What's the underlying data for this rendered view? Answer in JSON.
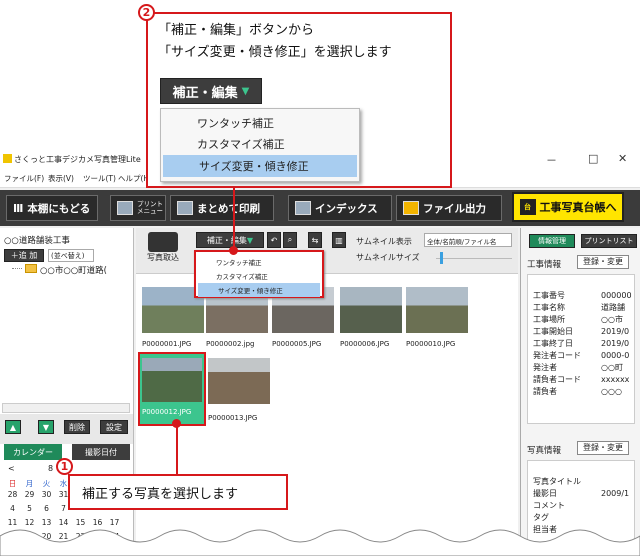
{
  "step2": {
    "number": "2",
    "line1": "「補正・編集」ボタンから",
    "line2": "「サイズ変更・傾き修正」を選択します",
    "button_label": "補正・編集",
    "menu": [
      "ワンタッチ補正",
      "カスタマイズ補正",
      "サイズ変更・傾き修正"
    ]
  },
  "step1": {
    "number": "1",
    "text": "補正する写真を選択します"
  },
  "window": {
    "title": "さくっと工事デジカメ写真管理Lite",
    "controls": [
      "－",
      "□",
      "✕"
    ]
  },
  "menubar": [
    "ファイル(F)",
    "表示(V)",
    "ツール(T)",
    "ヘルプ(H)"
  ],
  "toolbar": {
    "back": "本棚にもどる",
    "print_small": "プリント\nメニュー",
    "bulk_print": "まとめて印刷",
    "index": "インデックス",
    "file_output": "ファイル出力",
    "ledger": "工事写真台帳へ"
  },
  "left": {
    "project": "○○道路舗装工事",
    "add": "追 加",
    "sort": "(並べ替え)",
    "folder": "○○市○○町道路(",
    "delete": "削除",
    "settings": "設定",
    "calendar": "カレンダー",
    "shoot_date": "撮影日付",
    "month": "8",
    "weekdays": [
      "日",
      "月",
      "火",
      "水"
    ],
    "weeks": [
      [
        "28",
        "29",
        "30",
        "31"
      ],
      [
        "4",
        "5",
        "6",
        "7"
      ],
      [
        "11",
        "12",
        "13",
        "14",
        "15",
        "16",
        "17"
      ],
      [
        "18",
        "19",
        "20",
        "21",
        "22",
        "23",
        "24"
      ]
    ]
  },
  "middle": {
    "import": "写真取込",
    "edit_button": "補正・編集",
    "thumb_display_label": "サムネイル表示",
    "thumb_display_value": "全体/名前順/ファイル名",
    "thumb_size_label": "サムネイルサイズ",
    "menu": [
      "ワンタッチ補正",
      "カスタマイズ補正",
      "サイズ変更・傾き修正"
    ],
    "photos": [
      "P0000001.JPG",
      "P0000002.jpg",
      "P0000005.JPG",
      "P0000006.JPG",
      "P0000010.JPG",
      "P0000012.JPG",
      "P0000013.JPG"
    ]
  },
  "right": {
    "tab1": "情報管理",
    "tab2": "プリントリスト",
    "work_info": "工事情報",
    "register": "登録・変更",
    "work_fields": [
      [
        "工事番号",
        "000000"
      ],
      [
        "工事名称",
        "道路舗"
      ],
      [
        "工事場所",
        "○○市"
      ],
      [
        "工事開始日",
        "2019/0"
      ],
      [
        "工事終了日",
        "2019/0"
      ],
      [
        "発注者コード",
        "0000-0"
      ],
      [
        "発注者",
        "○○町"
      ],
      [
        "請負者コード",
        "xxxxxx"
      ],
      [
        "請負者",
        "○○○"
      ]
    ],
    "photo_info": "写真情報",
    "register2": "登録・変更",
    "photo_fields": [
      [
        "写真タイトル",
        ""
      ],
      [
        "撮影日",
        "2009/1"
      ],
      [
        "コメント",
        ""
      ],
      [
        "タグ",
        ""
      ],
      [
        "担当者",
        ""
      ]
    ]
  },
  "colors": {
    "accent_red": "#d6181b",
    "selected_green": "#3cc58e",
    "ledger_yellow": "#ffe500"
  }
}
